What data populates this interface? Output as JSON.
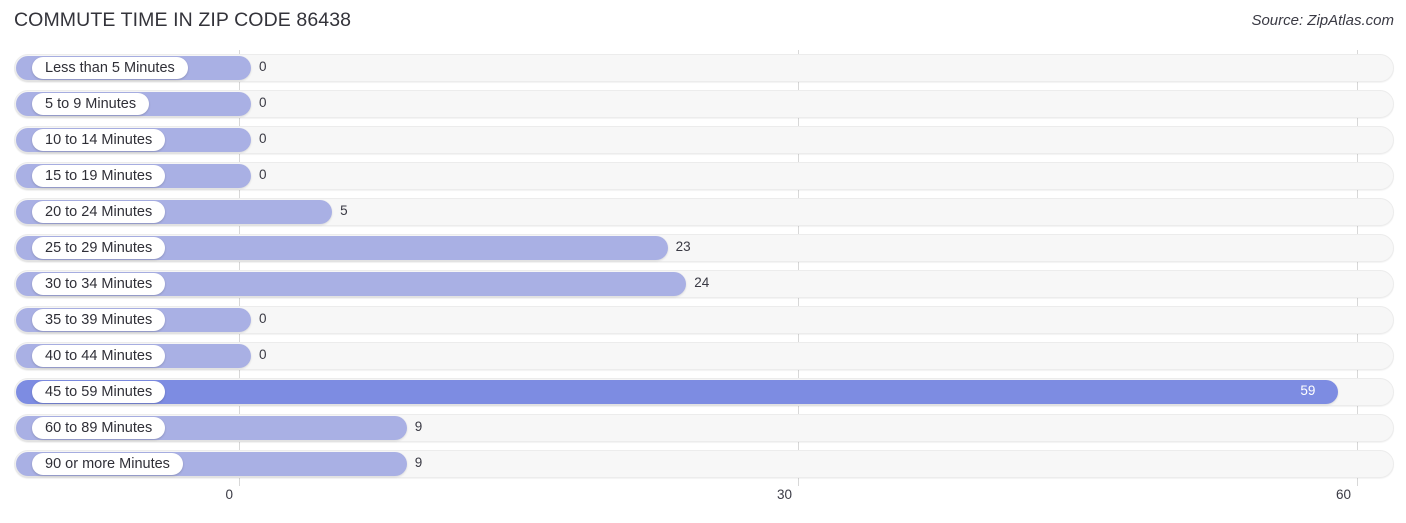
{
  "header": {
    "title": "COMMUTE TIME IN ZIP CODE 86438",
    "source": "Source: ZipAtlas.com"
  },
  "chart_data": {
    "type": "bar",
    "orientation": "horizontal",
    "title": "COMMUTE TIME IN ZIP CODE 86438",
    "xlabel": "",
    "ylabel": "",
    "xlim": [
      0,
      60
    ],
    "ticks": [
      "0",
      "30",
      "60"
    ],
    "tick_values": [
      0,
      30,
      60
    ],
    "grid": true,
    "legend": "none",
    "categories": [
      "Less than 5 Minutes",
      "5 to 9 Minutes",
      "10 to 14 Minutes",
      "15 to 19 Minutes",
      "20 to 24 Minutes",
      "25 to 29 Minutes",
      "30 to 34 Minutes",
      "35 to 39 Minutes",
      "40 to 44 Minutes",
      "45 to 59 Minutes",
      "60 to 89 Minutes",
      "90 or more Minutes"
    ],
    "values": [
      0,
      0,
      0,
      0,
      5,
      23,
      24,
      0,
      0,
      59,
      9,
      9
    ],
    "value_labels": [
      "0",
      "0",
      "0",
      "0",
      "5",
      "23",
      "24",
      "0",
      "0",
      "59",
      "9",
      "9"
    ],
    "highlight_index": 9,
    "colors": {
      "bar": "#a9b0e4",
      "bar_highlight": "#7d8ce2",
      "track": "#f7f7f7",
      "grid": "#d8d8d8",
      "text": "#3a3a44",
      "title": "#33333a"
    }
  }
}
